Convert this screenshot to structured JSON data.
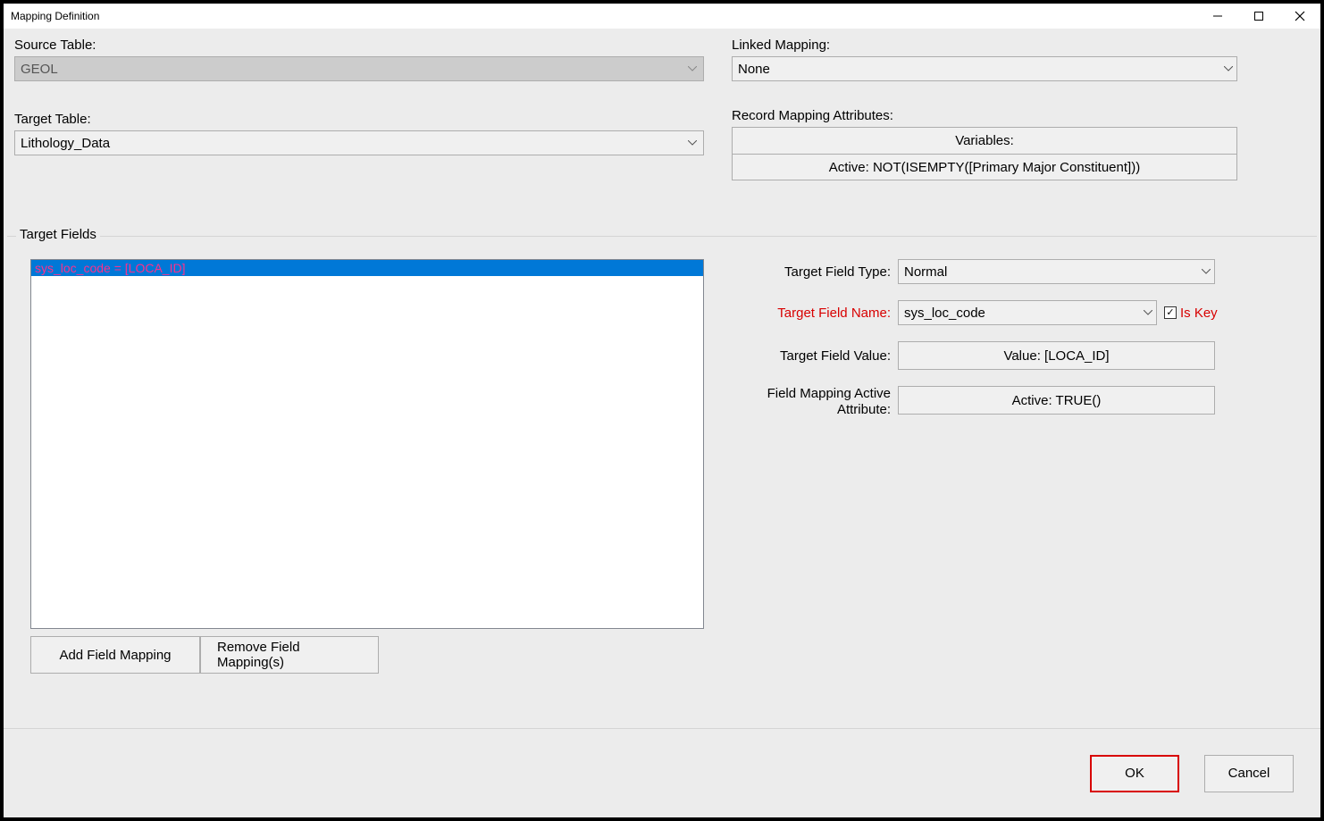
{
  "window": {
    "title": "Mapping Definition"
  },
  "source_table": {
    "label": "Source Table:",
    "value": "GEOL"
  },
  "target_table": {
    "label": "Target Table:",
    "value": "Lithology_Data"
  },
  "linked_mapping": {
    "label": "Linked Mapping:",
    "value": "None"
  },
  "record_attrs": {
    "label": "Record Mapping Attributes:",
    "variables_btn": "Variables:",
    "active_btn": "Active: NOT(ISEMPTY([Primary Major Constituent]))"
  },
  "target_fields": {
    "group_label": "Target Fields",
    "items": [
      "sys_loc_code = [LOCA_ID]"
    ],
    "add_btn": "Add Field Mapping",
    "remove_btn": "Remove Field Mapping(s)"
  },
  "field_detail": {
    "type_label": "Target Field Type:",
    "type_value": "Normal",
    "name_label": "Target Field Name:",
    "name_value": "sys_loc_code",
    "is_key_label": "Is Key",
    "is_key_checked": true,
    "value_label": "Target Field Value:",
    "value_btn": "Value: [LOCA_ID]",
    "active_label": "Field Mapping Active Attribute:",
    "active_btn": "Active: TRUE()"
  },
  "footer": {
    "ok": "OK",
    "cancel": "Cancel"
  },
  "icons": {
    "check": "✓"
  }
}
